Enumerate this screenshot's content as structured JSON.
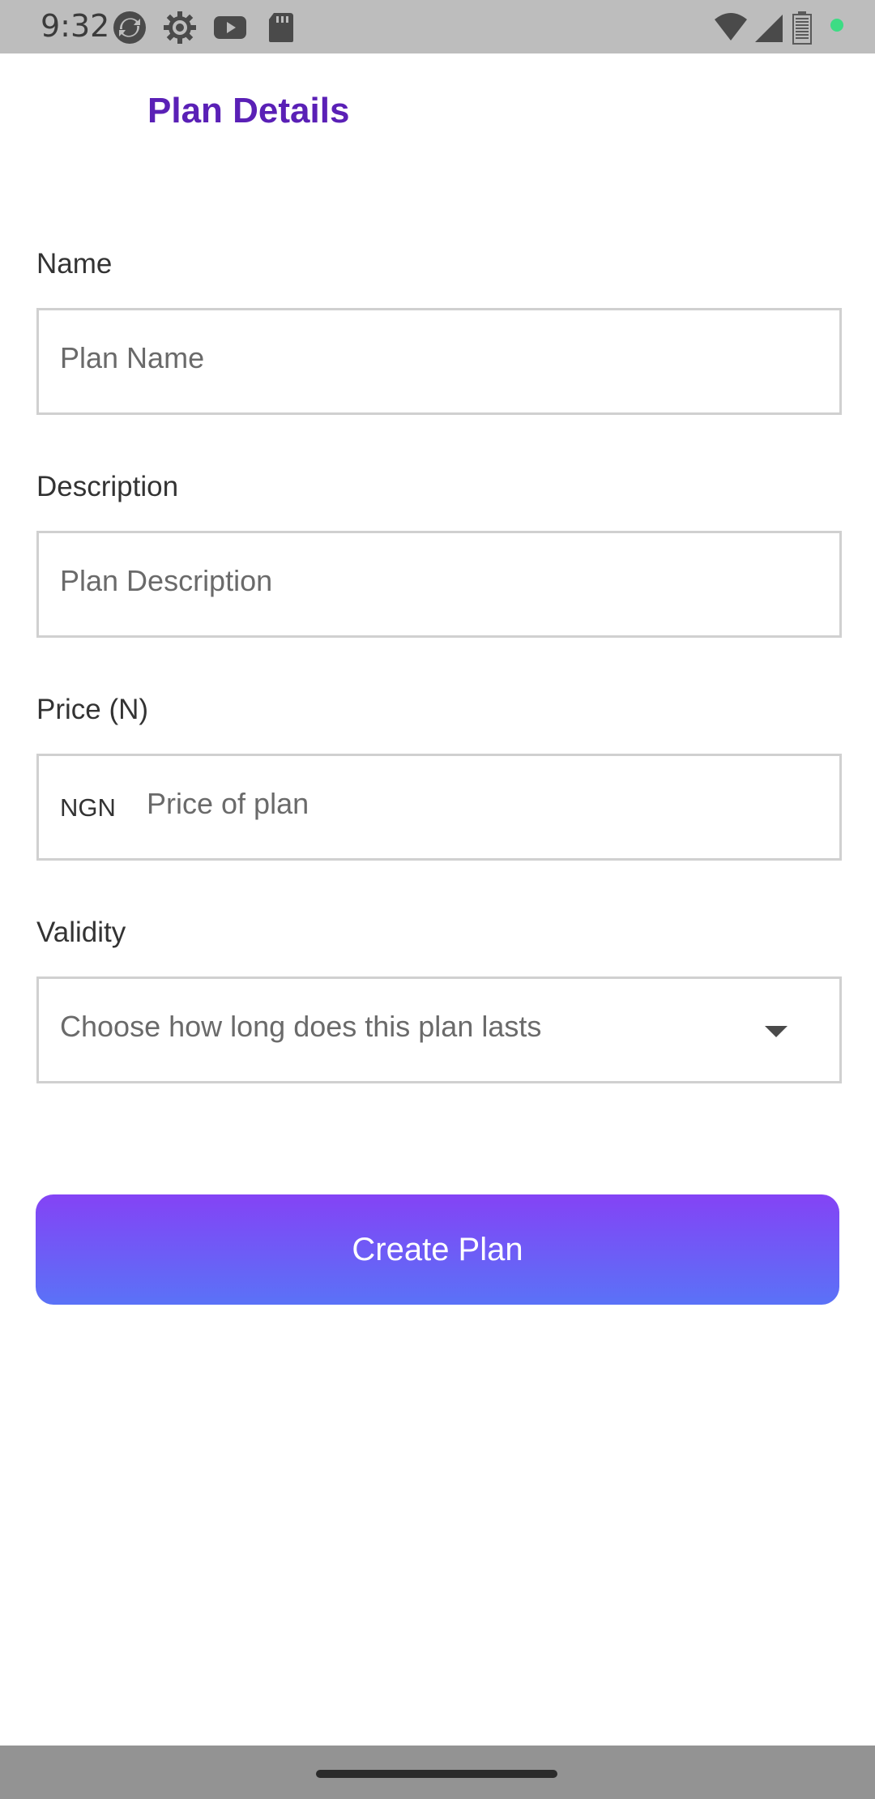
{
  "status_bar": {
    "time": "9:32",
    "icons": [
      "sync-icon",
      "settings-gear-icon",
      "youtube-icon",
      "sd-card-icon",
      "wifi-icon",
      "cell-signal-icon",
      "battery-icon",
      "notification-dot-icon"
    ]
  },
  "header": {
    "title": "Plan Details"
  },
  "form": {
    "name": {
      "label": "Name",
      "placeholder": "Plan Name"
    },
    "description": {
      "label": "Description",
      "placeholder": "Plan Description"
    },
    "price": {
      "label": "Price (N)",
      "prefix": "NGN",
      "placeholder": "Price of plan"
    },
    "validity": {
      "label": "Validity",
      "placeholder": "Choose how long does this plan lasts",
      "icon": "dropdown-arrow-icon"
    }
  },
  "actions": {
    "create_label": "Create Plan"
  },
  "colors": {
    "title": "#5a20b6",
    "button_top": "#8443f5",
    "button_bottom": "#5a72f7",
    "field_border": "#d0d0d0",
    "notification_dot": "#3ddc84"
  }
}
